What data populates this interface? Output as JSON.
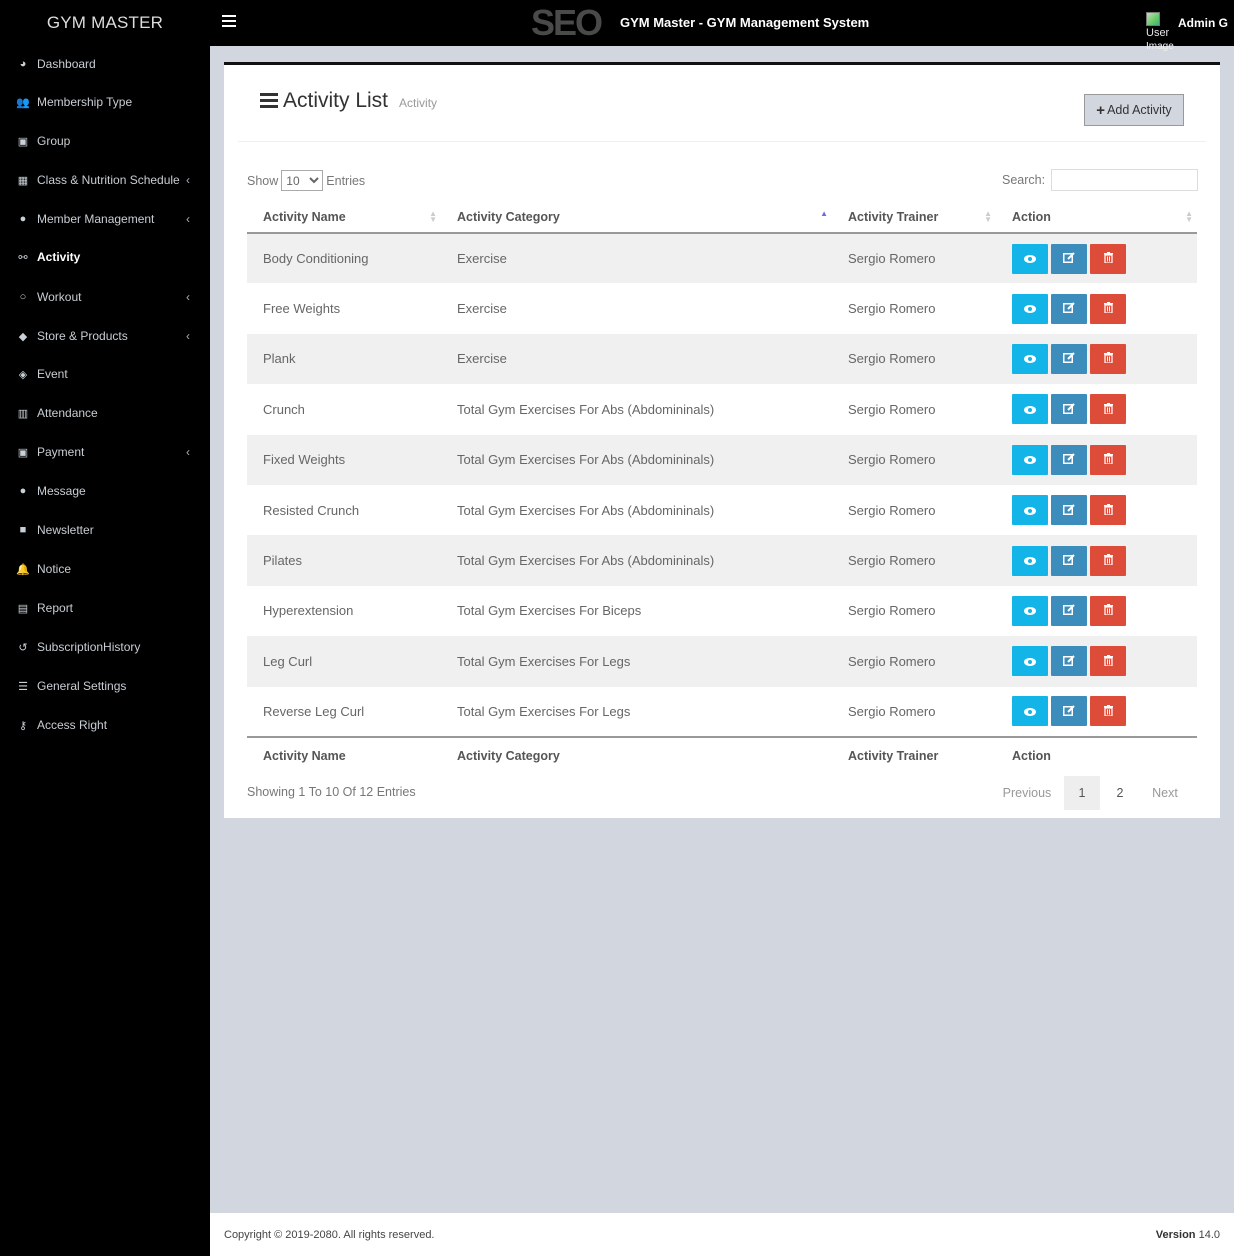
{
  "header": {
    "brand": "GYM MASTER",
    "logo_text": "SEO",
    "system_title": "GYM Master - GYM Management System",
    "user_image_alt": [
      "User",
      "Image"
    ],
    "user_name": "Admin G"
  },
  "sidebar": {
    "items": [
      {
        "label": "Dashboard",
        "icon": "dashboard-icon",
        "glyph": "◕",
        "submenu": false
      },
      {
        "label": "Membership Type",
        "icon": "users-icon",
        "glyph": "👥",
        "submenu": false
      },
      {
        "label": "Group",
        "icon": "group-icon",
        "glyph": "▣",
        "submenu": false
      },
      {
        "label": "Class & Nutrition Schedule",
        "icon": "calendar-icon",
        "glyph": "▦",
        "submenu": true
      },
      {
        "label": "Member Management",
        "icon": "user-icon",
        "glyph": "●",
        "submenu": true
      },
      {
        "label": "Activity",
        "icon": "bicycle-icon",
        "glyph": "⚯",
        "submenu": false,
        "active": true
      },
      {
        "label": "Workout",
        "icon": "workout-icon",
        "glyph": "○",
        "submenu": true
      },
      {
        "label": "Store & Products",
        "icon": "tags-icon",
        "glyph": "◆",
        "submenu": true
      },
      {
        "label": "Event",
        "icon": "ticket-icon",
        "glyph": "◈",
        "submenu": false
      },
      {
        "label": "Attendance",
        "icon": "attendance-icon",
        "glyph": "▥",
        "submenu": false
      },
      {
        "label": "Payment",
        "icon": "money-icon",
        "glyph": "▣",
        "submenu": true
      },
      {
        "label": "Message",
        "icon": "comment-icon",
        "glyph": "●",
        "submenu": false
      },
      {
        "label": "Newsletter",
        "icon": "newsletter-icon",
        "glyph": "■",
        "submenu": false
      },
      {
        "label": "Notice",
        "icon": "bell-icon",
        "glyph": "🔔",
        "submenu": false
      },
      {
        "label": "Report",
        "icon": "report-icon",
        "glyph": "▤",
        "submenu": false
      },
      {
        "label": "SubscriptionHistory",
        "icon": "history-icon",
        "glyph": "↺",
        "submenu": false
      },
      {
        "label": "General Settings",
        "icon": "sliders-icon",
        "glyph": "☰",
        "submenu": false
      },
      {
        "label": "Access Right",
        "icon": "key-icon",
        "glyph": "⚷",
        "submenu": false
      }
    ],
    "chevron": "‹"
  },
  "main": {
    "title": "Activity List",
    "subtitle": "Activity",
    "add_button": {
      "icon": "+",
      "label": "Add Activity"
    },
    "show_label": "Show",
    "entries_label": "Entries",
    "page_size": "10",
    "page_size_options": [
      "10"
    ],
    "search_label": "Search:",
    "search_value": "",
    "columns": [
      "Activity Name",
      "Activity Category",
      "Activity Trainer",
      "Action"
    ],
    "sorted_column": "Activity Category",
    "rows": [
      {
        "name": "Body Conditioning",
        "category": "Exercise",
        "trainer": "Sergio Romero"
      },
      {
        "name": "Free Weights",
        "category": "Exercise",
        "trainer": "Sergio Romero"
      },
      {
        "name": "Plank",
        "category": "Exercise",
        "trainer": "Sergio Romero"
      },
      {
        "name": "Crunch",
        "category": "Total Gym Exercises For Abs (Abdomininals)",
        "trainer": "Sergio Romero"
      },
      {
        "name": "Fixed Weights",
        "category": "Total Gym Exercises For Abs (Abdomininals)",
        "trainer": "Sergio Romero"
      },
      {
        "name": "Resisted Crunch",
        "category": "Total Gym Exercises For Abs (Abdomininals)",
        "trainer": "Sergio Romero"
      },
      {
        "name": "Pilates",
        "category": "Total Gym Exercises For Abs (Abdomininals)",
        "trainer": "Sergio Romero"
      },
      {
        "name": "Hyperextension",
        "category": "Total Gym Exercises For Biceps",
        "trainer": "Sergio Romero"
      },
      {
        "name": "Leg Curl",
        "category": "Total Gym Exercises For Legs",
        "trainer": "Sergio Romero"
      },
      {
        "name": "Reverse Leg Curl",
        "category": "Total Gym Exercises For Legs",
        "trainer": "Sergio Romero"
      }
    ],
    "info": "Showing 1 To 10 Of 12 Entries",
    "pagination": {
      "previous": "Previous",
      "pages": [
        "1",
        "2"
      ],
      "current": "1",
      "next": "Next"
    },
    "action_colors": {
      "view": "#13b5e8",
      "edit": "#3c8dbc",
      "delete": "#dd4b39"
    }
  },
  "footer": {
    "copyright": "Copyright © 2019-2080. All rights reserved.",
    "version_label": "Version",
    "version_value": "14.0"
  }
}
